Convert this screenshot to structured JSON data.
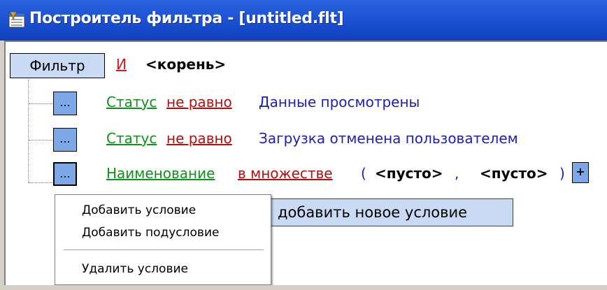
{
  "window": {
    "title": "Построитель фильтра - [untitled.flt]",
    "icon": "filter-app-icon"
  },
  "root": {
    "button_label": "Фильтр",
    "operator": "И",
    "label": "<корень>"
  },
  "conditions": [
    {
      "button_label": "...",
      "field": "Статус",
      "operator": "не равно",
      "value": "Данные просмотрены"
    },
    {
      "button_label": "...",
      "field": "Статус",
      "operator": "не равно",
      "value": "Загрузка отменена пользователем"
    },
    {
      "button_label": "...",
      "field": "Наименование",
      "operator": "в множестве",
      "open_paren": "(",
      "set_values": [
        "<пусто>",
        "<пусто>"
      ],
      "comma": ",",
      "close_paren": ")",
      "add_value_label": "+"
    }
  ],
  "add_new_condition_label": "добавить новое условие",
  "context_menu": {
    "items": [
      "Добавить условие",
      "Добавить подусловие",
      "Удалить условие"
    ]
  },
  "colors": {
    "titlebar": "#1f55d6",
    "field": "#10911a",
    "operator": "#b01010",
    "value": "#2020b0",
    "button": "#7da7e6"
  }
}
